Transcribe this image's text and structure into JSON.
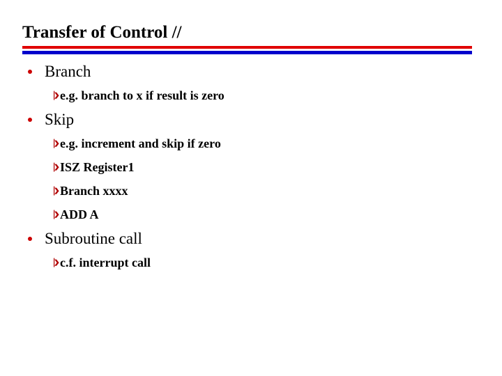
{
  "slide": {
    "title": "Transfer of Control //",
    "divider": {
      "top_rule_color": "#e00000",
      "bottom_rule_color": "#0000cc"
    },
    "bullet_color": "#cc0000",
    "arrow_color": "#b00000",
    "text_color": "#000000",
    "background_color": "#ffffff",
    "content": [
      {
        "level": 1,
        "bullet": "round-bullet",
        "text": "Branch"
      },
      {
        "level": 2,
        "bullet": "arrow-bullet",
        "text": "e.g. branch to x if result is zero"
      },
      {
        "level": 1,
        "bullet": "round-bullet",
        "text": "Skip"
      },
      {
        "level": 2,
        "bullet": "arrow-bullet",
        "text": "e.g. increment and skip if zero"
      },
      {
        "level": 2,
        "bullet": "arrow-bullet",
        "text": "ISZ Register1"
      },
      {
        "level": 2,
        "bullet": "arrow-bullet",
        "text": "Branch xxxx"
      },
      {
        "level": 2,
        "bullet": "arrow-bullet",
        "text": "ADD A"
      },
      {
        "level": 1,
        "bullet": "round-bullet",
        "text": "Subroutine call"
      },
      {
        "level": 2,
        "bullet": "arrow-bullet",
        "text": "c.f. interrupt call"
      }
    ]
  }
}
